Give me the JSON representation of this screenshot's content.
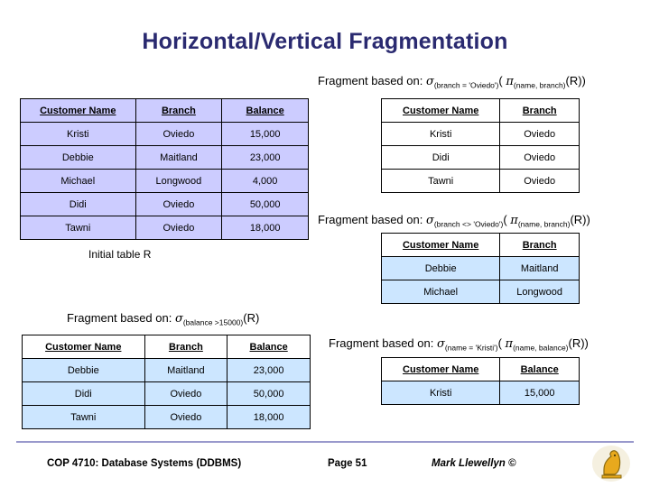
{
  "slide": {
    "title": "Horizontal/Vertical Fragmentation",
    "captions": {
      "initial_table": "Initial table R"
    },
    "formulas": {
      "f1": {
        "prefix": "Fragment based on: ",
        "sigma": "σ",
        "sigma_sub": "(branch = 'Oviedo')",
        "mid": "( ",
        "pi": "π",
        "pi_sub": "(name, branch)",
        "suffix": "(R))"
      },
      "f2": {
        "prefix": "Fragment based on: ",
        "sigma": "σ",
        "sigma_sub": "(branch <> 'Oviedo')",
        "mid": "( ",
        "pi": "π",
        "pi_sub": "(name, branch)",
        "suffix": "(R))"
      },
      "f3": {
        "prefix": "Fragment based on: ",
        "sigma": "σ",
        "sigma_sub": "(balance >15000)",
        "mid": "",
        "pi": "",
        "pi_sub": "",
        "suffix": "(R)"
      },
      "f4": {
        "prefix": "Fragment based on: ",
        "sigma": "σ",
        "sigma_sub": "(name = 'Kristi')",
        "mid": "( ",
        "pi": "π",
        "pi_sub": "(name, balance)",
        "suffix": "(R))"
      }
    },
    "tables": {
      "initial": {
        "headers": [
          "Customer Name",
          "Branch",
          "Balance"
        ],
        "rows": [
          [
            "Kristi",
            "Oviedo",
            "15,000"
          ],
          [
            "Debbie",
            "Maitland",
            "23,000"
          ],
          [
            "Michael",
            "Longwood",
            "4,000"
          ],
          [
            "Didi",
            "Oviedo",
            "50,000"
          ],
          [
            "Tawni",
            "Oviedo",
            "18,000"
          ]
        ]
      },
      "frag_oviedo": {
        "headers": [
          "Customer Name",
          "Branch"
        ],
        "rows": [
          [
            "Kristi",
            "Oviedo"
          ],
          [
            "Didi",
            "Oviedo"
          ],
          [
            "Tawni",
            "Oviedo"
          ]
        ]
      },
      "frag_not_oviedo": {
        "headers": [
          "Customer Name",
          "Branch"
        ],
        "rows": [
          [
            "Debbie",
            "Maitland"
          ],
          [
            "Michael",
            "Longwood"
          ]
        ]
      },
      "frag_balance": {
        "headers": [
          "Customer Name",
          "Branch",
          "Balance"
        ],
        "rows": [
          [
            "Debbie",
            "Maitland",
            "23,000"
          ],
          [
            "Didi",
            "Oviedo",
            "50,000"
          ],
          [
            "Tawni",
            "Oviedo",
            "18,000"
          ]
        ]
      },
      "frag_kristi": {
        "headers": [
          "Customer Name",
          "Balance"
        ],
        "rows": [
          [
            "Kristi",
            "15,000"
          ]
        ]
      }
    },
    "footer": {
      "left": "COP 4710: Database Systems  (DDBMS)",
      "center": "Page 51",
      "right": "Mark Llewellyn ©"
    },
    "colors": {
      "title": "#2a2a70",
      "purple_header": "#ccccff",
      "blue_rows": "#cce6ff",
      "footer_rule": "#9999cc"
    }
  }
}
